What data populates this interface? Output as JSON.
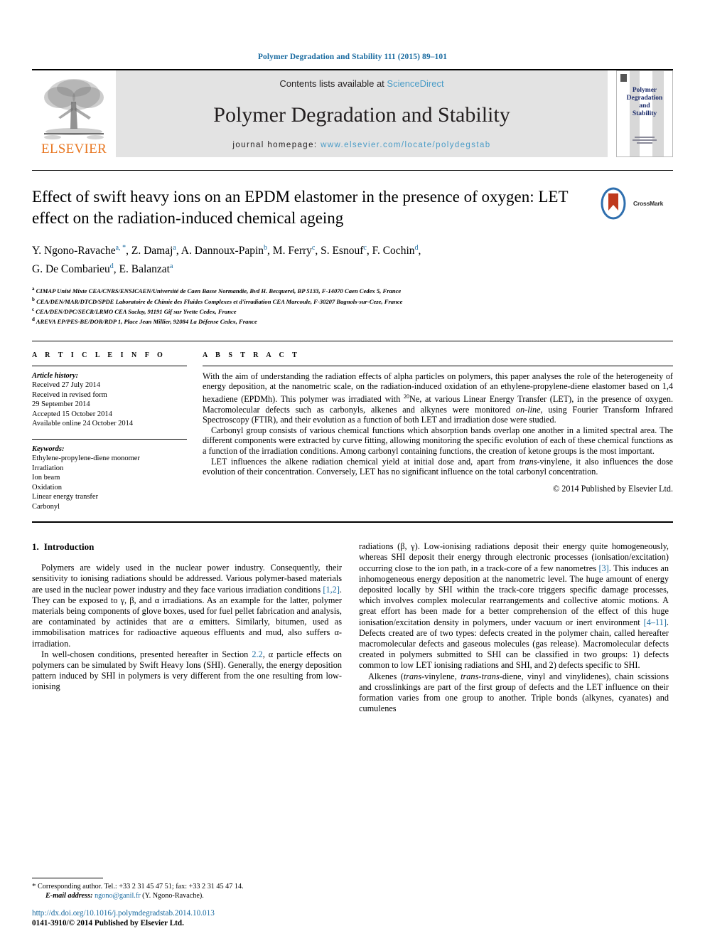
{
  "running_head": "Polymer Degradation and Stability 111 (2015) 89–101",
  "masthead": {
    "publisher_logo_text": "ELSEVIER",
    "contents_prefix": "Contents lists available at ",
    "contents_link": "ScienceDirect",
    "journal_title": "Polymer Degradation and Stability",
    "homepage_prefix": "journal homepage: ",
    "homepage_url": "www.elsevier.com/locate/polydegstab",
    "cover_title_lines": [
      "Polymer",
      "Degradation",
      "and",
      "Stability"
    ],
    "link_color": "#4a9cc7",
    "cover_text_color": "#1c2c6b",
    "elsevier_orange": "#E87722"
  },
  "article": {
    "title": "Effect of swift heavy ions on an EPDM elastomer in the presence of oxygen: LET effect on the radiation-induced chemical ageing",
    "crossmark_label": "CrossMark",
    "authors_line_1_parts": [
      {
        "name": "Y. Ngono-Ravache",
        "sup": "a, *"
      },
      {
        "name": "Z. Damaj",
        "sup": "a"
      },
      {
        "name": "A. Dannoux-Papin",
        "sup": "b"
      },
      {
        "name": "M. Ferry",
        "sup": "c"
      },
      {
        "name": "S. Esnouf",
        "sup": "c"
      },
      {
        "name": "F. Cochin",
        "sup": "d"
      }
    ],
    "authors_line_2_parts": [
      {
        "name": "G. De Combarieu",
        "sup": "d"
      },
      {
        "name": "E. Balanzat",
        "sup": "a"
      }
    ],
    "affiliations": [
      {
        "mark": "a",
        "text": "CIMAP Unité Mixte CEA/CNRS/ENSICAEN/Université de Caen Basse Normandie, Bvd H. Becquerel, BP 5133, F-14070 Caen Cedex 5, France"
      },
      {
        "mark": "b",
        "text": "CEA/DEN/MAR/DTCD/SPDE Laboratoire de Chimie des Fluides Complexes et d'irradiation CEA Marcoule, F-30207 Bagnols-sur-Ceze, France"
      },
      {
        "mark": "c",
        "text": "CEA/DEN/DPC/SECR/LRMO CEA Saclay, 91191 Gif sur Yvette Cedex, France"
      },
      {
        "mark": "d",
        "text": "AREVA EP/PES-BE/DOR/RDP 1, Place Jean Millier, 92084 La Défense Cedex, France"
      }
    ]
  },
  "article_info": {
    "heading": "A R T I C L E   I N F O",
    "history_label": "Article history:",
    "history": [
      "Received 27 July 2014",
      "Received in revised form",
      "29 September 2014",
      "Accepted 15 October 2014",
      "Available online 24 October 2014"
    ],
    "keywords_label": "Keywords:",
    "keywords": [
      "Ethylene-propylene-diene monomer",
      "Irradiation",
      "Ion beam",
      "Oxidation",
      "Linear energy transfer",
      "Carbonyl"
    ]
  },
  "abstract": {
    "heading": "A B S T R A C T",
    "paragraph_1_a": "With the aim of understanding the radiation effects of alpha particles on polymers, this paper analyses the role of the heterogeneity of energy deposition, at the nanometric scale, on the radiation-induced oxidation of an ethylene-propylene-diene elastomer based on 1,4 hexadiene (EPDMh). This polymer was irradiated with ",
    "paragraph_1_sup": "20",
    "paragraph_1_b": "Ne, at various Linear Energy Transfer (LET), in the presence of oxygen. Macromolecular defects such as carbonyls, alkenes and alkynes were monitored ",
    "paragraph_1_italic": "on-line",
    "paragraph_1_c": ", using Fourier Transform Infrared Spectroscopy (FTIR), and their evolution as a function of both LET and irradiation dose were studied.",
    "paragraph_2": "Carbonyl group consists of various chemical functions which absorption bands overlap one another in a limited spectral area. The different components were extracted by curve fitting, allowing monitoring the specific evolution of each of these chemical functions as a function of the irradiation conditions. Among carbonyl containing functions, the creation of ketone groups is the most important.",
    "paragraph_3_a": "LET influences the alkene radiation chemical yield at initial dose and, apart from ",
    "paragraph_3_italic": "trans",
    "paragraph_3_b": "-vinylene, it also influences the dose evolution of their concentration. Conversely, LET has no significant influence on the total carbonyl concentration.",
    "copyright": "© 2014 Published by Elsevier Ltd."
  },
  "introduction": {
    "number": "1.",
    "heading": "Introduction",
    "left_p1_a": "Polymers are widely used in the nuclear power industry. Consequently, their sensitivity to ionising radiations should be addressed. Various polymer-based materials are used in the nuclear power industry and they face various irradiation conditions ",
    "left_p1_ref": "[1,2]",
    "left_p1_b": ". They can be exposed to γ, β, and α irradiations. As an example for the latter, polymer materials being components of glove boxes, used for fuel pellet fabrication and analysis, are contaminated by actinides that are α emitters. Similarly, bitumen, used as immobilisation matrices for radioactive aqueous effluents and mud, also suffers α-irradiation.",
    "left_p2_a": "In well-chosen conditions, presented hereafter in Section ",
    "left_p2_ref": "2.2",
    "left_p2_b": ", α particle effects on polymers can be simulated by Swift Heavy Ions (SHI). Generally, the energy deposition pattern induced by SHI in polymers is very different from the one resulting from low-ionising",
    "right_p1_a": "radiations (β, γ). Low-ionising radiations deposit their energy quite homogeneously, whereas SHI deposit their energy through electronic processes (ionisation/excitation) occurring close to the ion path, in a track-core of a few nanometres ",
    "right_p1_ref1": "[3]",
    "right_p1_b": ". This induces an inhomogeneous energy deposition at the nanometric level. The huge amount of energy deposited locally by SHI within the track-core triggers specific damage processes, which involves complex molecular rearrangements and collective atomic motions. A great effort has been made for a better comprehension of the effect of this huge ionisation/excitation density in polymers, under vacuum or inert environment ",
    "right_p1_ref2": "[4–11]",
    "right_p1_c": ". Defects created are of two types: defects created in the polymer chain, called hereafter macromolecular defects and gaseous molecules (gas release). Macromolecular defects created in polymers submitted to SHI can be classified in two groups: 1) defects common to low LET ionising radiations and SHI, and 2) defects specific to SHI.",
    "right_p2_a": "Alkenes (",
    "right_p2_i1": "trans",
    "right_p2_b": "-vinylene, ",
    "right_p2_i2": "trans-trans",
    "right_p2_c": "-diene, vinyl and vinylidenes), chain scissions and crosslinkings are part of the first group of defects and the LET influence on their formation varies from one group to another. Triple bonds (alkynes, cyanates) and cumulenes"
  },
  "footer": {
    "corresponding_star": "*",
    "corresponding_text": "Corresponding author. Tel.: +33 2 31 45 47 51; fax: +33 2 31 45 47 14.",
    "email_label": "E-mail address:",
    "email": "ngono@ganil.fr",
    "email_suffix": "(Y. Ngono-Ravache).",
    "doi": "http://dx.doi.org/10.1016/j.polymdegradstab.2014.10.013",
    "issn_line": "0141-3910/© 2014 Published by Elsevier Ltd.",
    "link_color": "#1a6ba0"
  }
}
